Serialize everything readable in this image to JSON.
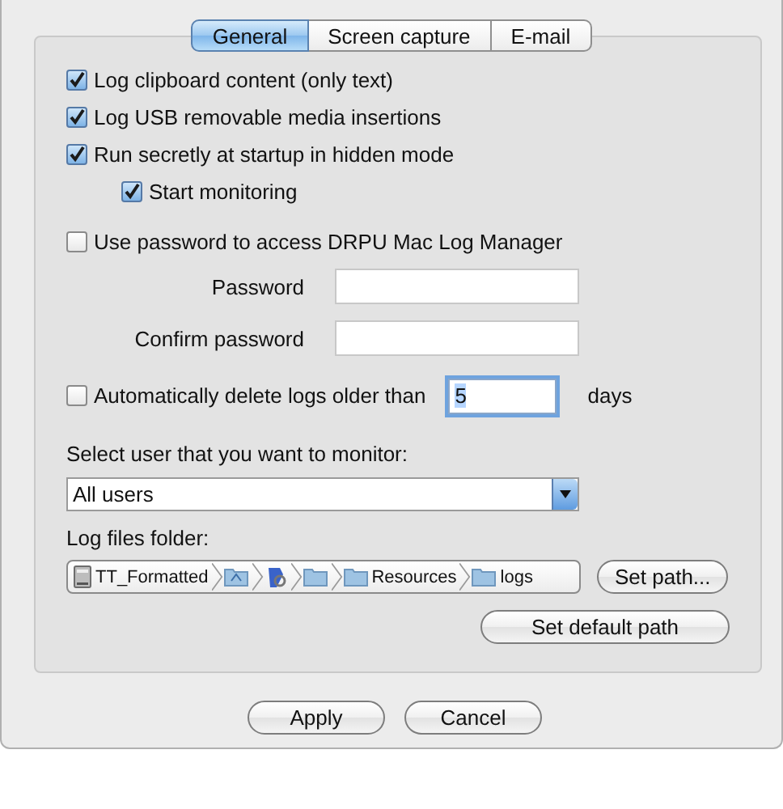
{
  "tabs": [
    {
      "label": "General",
      "selected": true
    },
    {
      "label": "Screen capture",
      "selected": false
    },
    {
      "label": "E-mail",
      "selected": false
    }
  ],
  "options": [
    {
      "label": "Log clipboard content (only text)",
      "checked": true
    },
    {
      "label": "Log USB removable media insertions",
      "checked": true
    },
    {
      "label": "Run secretly at startup in hidden mode",
      "checked": true,
      "children": [
        {
          "label": "Start monitoring",
          "checked": true
        }
      ]
    }
  ],
  "password": {
    "label": "Use password to access DRPU Mac Log Manager",
    "checked": false,
    "fields": [
      {
        "label": "Password"
      },
      {
        "label": "Confirm password"
      }
    ]
  },
  "auto_delete": {
    "label": "Automatically delete logs older than",
    "checked": false,
    "value": "5",
    "focused": true,
    "unit": "days"
  },
  "user_select": {
    "label": "Select user that you want to monitor:",
    "value": "All users"
  },
  "log_folder": {
    "label": "Log files folder:",
    "path": [
      {
        "kind": "disk",
        "label": "TT_Formatted"
      },
      {
        "kind": "special-folder"
      },
      {
        "kind": "app"
      },
      {
        "kind": "folder"
      },
      {
        "kind": "folder",
        "label": "Resources"
      },
      {
        "kind": "folder",
        "label": "logs"
      }
    ],
    "buttons": [
      "Set path...",
      "Set default path"
    ]
  },
  "buttons": [
    "Apply",
    "Cancel"
  ]
}
